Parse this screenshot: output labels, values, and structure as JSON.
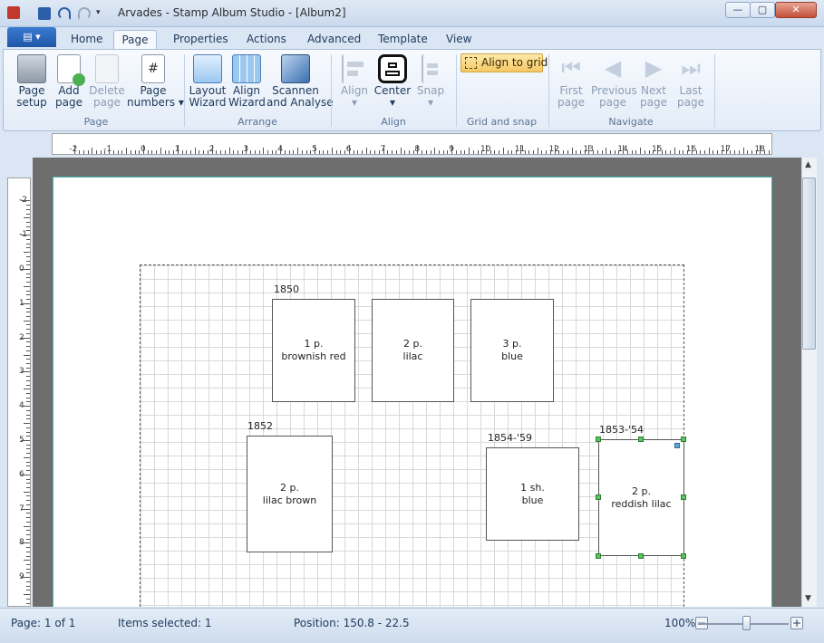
{
  "window": {
    "title": "Arvades - Stamp Album Studio - [Album2]"
  },
  "ribbon": {
    "app_menu_label": "▤ ▾",
    "tabs": [
      "Home",
      "Page",
      "Properties",
      "Actions",
      "Advanced",
      "Template",
      "View"
    ],
    "active_tab": "Page",
    "page_group": {
      "label": "Page",
      "buttons": [
        {
          "label": "Page\nsetup",
          "line1": "Page",
          "line2": "setup"
        },
        {
          "line1": "Add",
          "line2": "page"
        },
        {
          "line1": "Delete",
          "line2": "page"
        },
        {
          "line1": "Page",
          "line2": "numbers ▾"
        }
      ]
    },
    "arrange_group": {
      "label": "Arrange",
      "buttons": [
        {
          "line1": "Layout",
          "line2": "Wizard"
        },
        {
          "line1": "Align",
          "line2": "Wizard"
        },
        {
          "line1": "Scannen",
          "line2": "and Analyse"
        }
      ]
    },
    "align_group": {
      "label": "Align",
      "buttons": [
        {
          "line1": "Align",
          "line2": "▾"
        },
        {
          "line1": "Center",
          "line2": "▾"
        },
        {
          "line1": "Snap",
          "line2": "▾"
        }
      ]
    },
    "grid_group": {
      "label": "Grid and snap",
      "align_to_grid": "Align to grid"
    },
    "navigate_group": {
      "label": "Navigate",
      "buttons": [
        {
          "line1": "First",
          "line2": "page"
        },
        {
          "line1": "Previous",
          "line2": "page"
        },
        {
          "line1": "Next",
          "line2": "page"
        },
        {
          "line1": "Last",
          "line2": "page"
        }
      ]
    }
  },
  "rulers": {
    "horizontal": [
      "-2",
      "-1",
      "0",
      "1",
      "2",
      "3",
      "4",
      "5",
      "6",
      "7",
      "8",
      "9",
      "10",
      "11",
      "12",
      "13",
      "14",
      "15",
      "16",
      "17",
      "18"
    ],
    "vertical": [
      "-2",
      "-1",
      "0",
      "1",
      "2",
      "3",
      "4",
      "5",
      "6",
      "7",
      "8",
      "9"
    ]
  },
  "album": {
    "groups": [
      {
        "year": "1850",
        "stamps": [
          {
            "value": "1 p.",
            "color": "brownish red"
          },
          {
            "value": "2 p.",
            "color": "lilac"
          },
          {
            "value": "3 p.",
            "color": "blue"
          }
        ]
      },
      {
        "year": "1852",
        "stamps": [
          {
            "value": "2 p.",
            "color": "lilac brown"
          }
        ]
      },
      {
        "year": "1854-'59",
        "stamps": [
          {
            "value": "1 sh.",
            "color": "blue"
          }
        ]
      },
      {
        "year": "1853-'54",
        "stamps": [
          {
            "value": "2 p.",
            "color": "reddish lilac"
          }
        ]
      }
    ]
  },
  "status": {
    "page": "Page: 1 of 1",
    "selected": "Items selected: 1",
    "position": "Position: 150.8 - 22.5",
    "zoom": "100%"
  }
}
